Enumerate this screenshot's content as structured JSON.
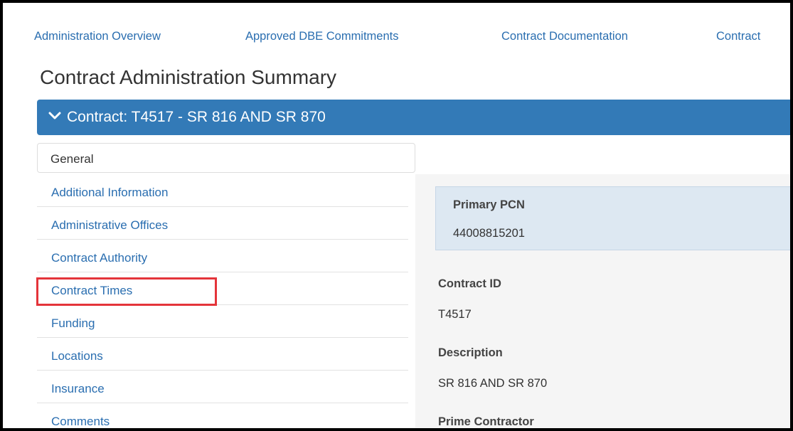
{
  "top_nav": {
    "items": [
      {
        "label": "Administration Overview"
      },
      {
        "label": "Approved DBE Commitments"
      },
      {
        "label": "Contract Documentation"
      },
      {
        "label": "Contract"
      }
    ]
  },
  "page_title": "Contract Administration Summary",
  "contract_header": {
    "icon": "chevron-down-icon",
    "label": "Contract: T4517 - SR 816 AND SR 870",
    "color": "#337ab7"
  },
  "sidebar": {
    "active_label": "General",
    "items": [
      {
        "label": "Additional Information"
      },
      {
        "label": "Administrative Offices"
      },
      {
        "label": "Contract Authority"
      },
      {
        "label": "Contract Times"
      },
      {
        "label": "Funding"
      },
      {
        "label": "Locations"
      },
      {
        "label": "Insurance"
      },
      {
        "label": "Comments"
      }
    ],
    "highlight_color": "#e4343a"
  },
  "details": {
    "primary_pcn": {
      "label": "Primary PCN",
      "value": "44008815201"
    },
    "contract_id": {
      "label": "Contract ID",
      "value": "T4517"
    },
    "description": {
      "label": "Description",
      "value": "SR 816 AND SR 870"
    },
    "prime_contractor": {
      "label": "Prime Contractor"
    }
  }
}
